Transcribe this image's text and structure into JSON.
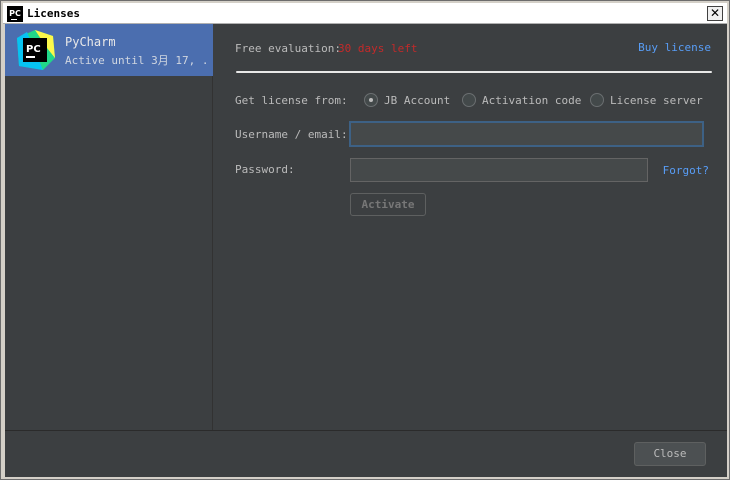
{
  "window": {
    "title": "Licenses",
    "icon_text": "PC",
    "close_glyph": "✕"
  },
  "sidebar": {
    "items": [
      {
        "name": "PyCharm",
        "status": "Active until 3月 17, ...",
        "icon": "pycharm-logo-icon",
        "logo_text": "PC"
      }
    ]
  },
  "evaluation": {
    "label": "Free evaluation:",
    "value": "30 days left",
    "value_color": "#c32a2a"
  },
  "buy_license_label": "Buy license",
  "license_source": {
    "label": "Get license from:",
    "options": [
      {
        "label": "JB Account",
        "selected": true
      },
      {
        "label": "Activation code",
        "selected": false
      },
      {
        "label": "License server",
        "selected": false
      }
    ]
  },
  "form": {
    "username_label": "Username / email:",
    "username_value": "",
    "password_label": "Password:",
    "password_value": "",
    "forgot_label": "Forgot?",
    "activate_label": "Activate"
  },
  "footer": {
    "close_label": "Close"
  },
  "colors": {
    "accent": "#4b6eaf",
    "link": "#589df6",
    "background": "#3c3f41"
  }
}
